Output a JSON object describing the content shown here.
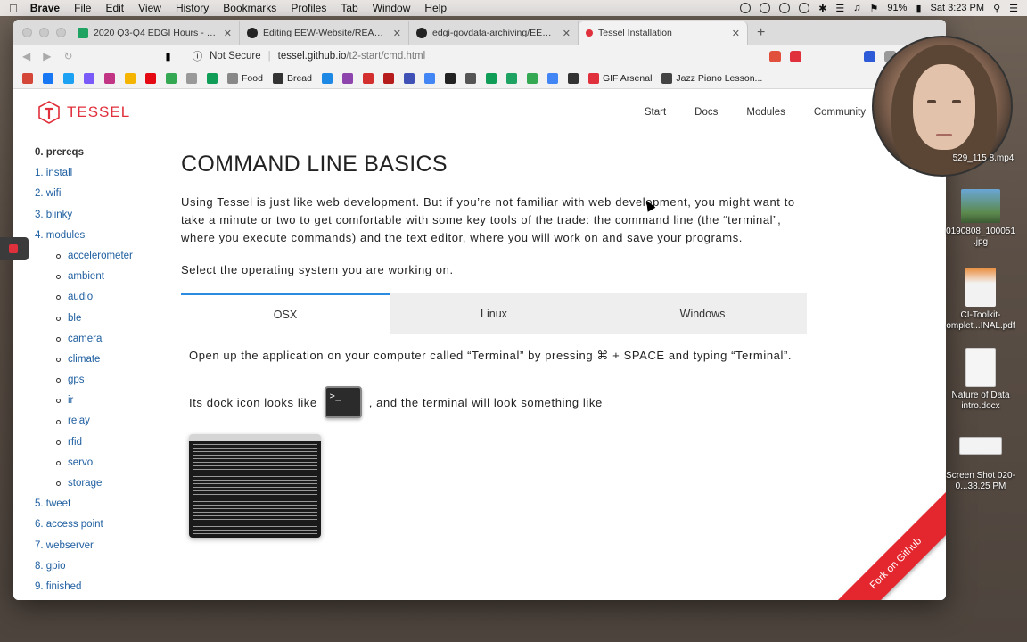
{
  "menubar": {
    "app": "Brave",
    "items": [
      "File",
      "Edit",
      "View",
      "History",
      "Bookmarks",
      "Profiles",
      "Tab",
      "Window",
      "Help"
    ],
    "battery": "91%",
    "clock": "Sat 3:23 PM"
  },
  "tabs": [
    {
      "label": "2020 Q3-Q4 EDGI Hours - Goog",
      "color": "#1ea362"
    },
    {
      "label": "Editing EEW-Website/README.r",
      "color": "#222222"
    },
    {
      "label": "edgi-govdata-archiving/EEW-W",
      "color": "#222222"
    },
    {
      "label": "Tessel Installation",
      "color": "#e0303c"
    }
  ],
  "toolbar": {
    "security": "Not Secure",
    "url_host": "tessel.github.io",
    "url_path": "/t2-start/cmd.html"
  },
  "bookmarks": [
    {
      "label": "",
      "color": "#d44638"
    },
    {
      "label": "",
      "color": "#1877f2"
    },
    {
      "label": "",
      "color": "#1da1f2"
    },
    {
      "label": "",
      "color": "#7a5af8"
    },
    {
      "label": "",
      "color": "#c13584"
    },
    {
      "label": "",
      "color": "#f4b400"
    },
    {
      "label": "",
      "color": "#e50914"
    },
    {
      "label": "",
      "color": "#34a853"
    },
    {
      "label": "",
      "color": "#999999"
    },
    {
      "label": "",
      "color": "#0f9d58"
    },
    {
      "label": "Food",
      "color": "#888888"
    },
    {
      "label": "Bread",
      "color": "#333333"
    },
    {
      "label": "",
      "color": "#1e88e5"
    },
    {
      "label": "",
      "color": "#8e44ad"
    },
    {
      "label": "",
      "color": "#d32f2f"
    },
    {
      "label": "",
      "color": "#b71c1c"
    },
    {
      "label": "",
      "color": "#3f51b5"
    },
    {
      "label": "",
      "color": "#4285f4"
    },
    {
      "label": "",
      "color": "#222222"
    },
    {
      "label": "",
      "color": "#555555"
    },
    {
      "label": "",
      "color": "#0f9d58"
    },
    {
      "label": "",
      "color": "#1ea362"
    },
    {
      "label": "",
      "color": "#34a853"
    },
    {
      "label": "",
      "color": "#4285f4"
    },
    {
      "label": "",
      "color": "#333333"
    },
    {
      "label": "GIF Arsenal",
      "color": "#e0303c"
    },
    {
      "label": "Jazz Piano Lesson...",
      "color": "#444444"
    }
  ],
  "site": {
    "logo": "TESSEL",
    "nav": [
      "Start",
      "Docs",
      "Modules",
      "Community"
    ]
  },
  "sidebar": {
    "items": [
      {
        "label": "0. prereqs",
        "current": true,
        "sub": false
      },
      {
        "label": "1. install",
        "current": false,
        "sub": false
      },
      {
        "label": "2. wifi",
        "current": false,
        "sub": false
      },
      {
        "label": "3. blinky",
        "current": false,
        "sub": false
      },
      {
        "label": "4. modules",
        "current": false,
        "sub": false
      },
      {
        "label": "accelerometer",
        "current": false,
        "sub": true
      },
      {
        "label": "ambient",
        "current": false,
        "sub": true
      },
      {
        "label": "audio",
        "current": false,
        "sub": true
      },
      {
        "label": "ble",
        "current": false,
        "sub": true
      },
      {
        "label": "camera",
        "current": false,
        "sub": true
      },
      {
        "label": "climate",
        "current": false,
        "sub": true
      },
      {
        "label": "gps",
        "current": false,
        "sub": true
      },
      {
        "label": "ir",
        "current": false,
        "sub": true
      },
      {
        "label": "relay",
        "current": false,
        "sub": true
      },
      {
        "label": "rfid",
        "current": false,
        "sub": true
      },
      {
        "label": "servo",
        "current": false,
        "sub": true
      },
      {
        "label": "storage",
        "current": false,
        "sub": true
      },
      {
        "label": "5. tweet",
        "current": false,
        "sub": false
      },
      {
        "label": "6. access point",
        "current": false,
        "sub": false
      },
      {
        "label": "7. webserver",
        "current": false,
        "sub": false
      },
      {
        "label": "8. gpio",
        "current": false,
        "sub": false
      },
      {
        "label": "9. finished",
        "current": false,
        "sub": false
      }
    ]
  },
  "content": {
    "title": "COMMAND LINE BASICS",
    "intro": "Using Tessel is just like web development. But if you’re not familiar with web development, you might want to take a minute or two to get comfortable with some key tools of the trade: the command line (the “terminal”, where you execute commands) and the text editor, where you will work on and save your programs.",
    "select_os": "Select the operating system you are working on.",
    "os_tabs": [
      "OSX",
      "Linux",
      "Windows"
    ],
    "osx_text": "Open up the application on your computer called “Terminal” by pressing ⌘ + SPACE and typing “Terminal”.",
    "dock_before": "Its dock icon looks like",
    "dock_after": ", and the terminal will look something like",
    "term_icon_text": ">_",
    "fork_ribbon": "Fork on Github"
  },
  "desktop": {
    "icons": [
      {
        "label": "529_115 8.mp4",
        "kind": "video"
      },
      {
        "label": "0190808_100051 .jpg",
        "kind": "photo"
      },
      {
        "label": "CI-Toolkit- omplet...INAL.pdf",
        "kind": "pdf"
      },
      {
        "label": "Nature of Data intro.docx",
        "kind": "docx"
      },
      {
        "label": "Screen Shot 020-0...38.25 PM",
        "kind": "shot"
      }
    ]
  }
}
